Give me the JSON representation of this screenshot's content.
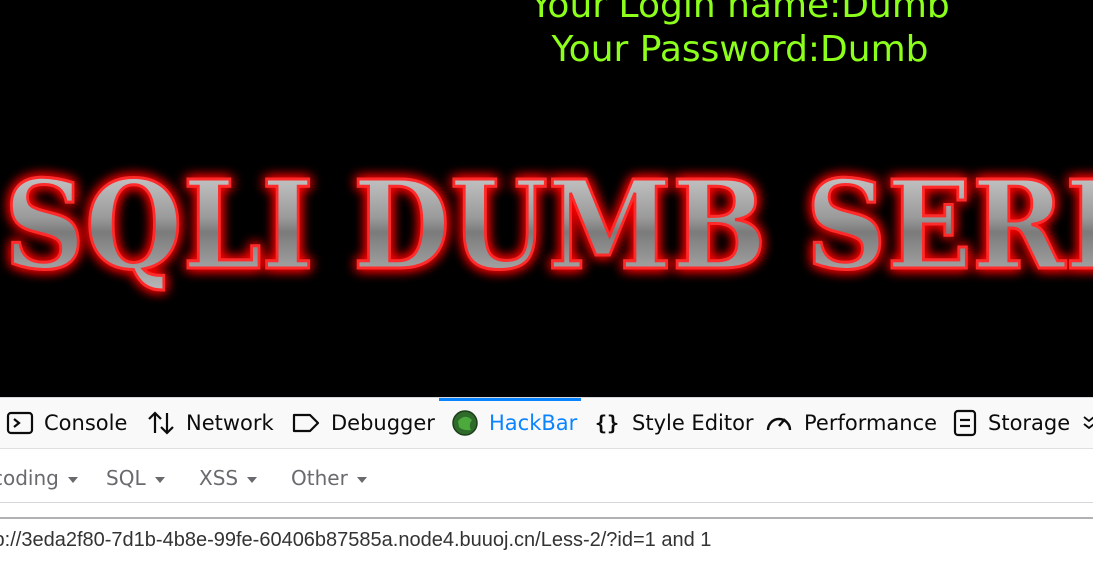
{
  "page": {
    "login_line": "Your Login name:Dumb",
    "password_line": "Your Password:Dumb",
    "banner_text": "SQLI DUMB SERIES"
  },
  "devtools": {
    "tabs": [
      {
        "label": "Console",
        "icon": "console-icon"
      },
      {
        "label": "Network",
        "icon": "network-icon"
      },
      {
        "label": "Debugger",
        "icon": "debugger-icon"
      },
      {
        "label": "HackBar",
        "icon": "hackbar-icon",
        "selected": true
      },
      {
        "label": "Style Editor",
        "icon": "style-editor-icon"
      },
      {
        "label": "Performance",
        "icon": "performance-icon"
      },
      {
        "label": "Storage",
        "icon": "storage-icon"
      }
    ],
    "overflow_icon": "chevron-more-icon",
    "hackbar_menus": [
      {
        "label": "coding"
      },
      {
        "label": "SQL"
      },
      {
        "label": "XSS"
      },
      {
        "label": "Other"
      }
    ],
    "url_value": "tp://3eda2f80-7d1b-4b8e-99fe-60406b87585a.node4.buuoj.cn/Less-2/?id=1 and 1"
  },
  "colors": {
    "login_text": "#8cff1a",
    "accent_blue": "#0a84ff",
    "banner_glow": "#ff0000"
  }
}
